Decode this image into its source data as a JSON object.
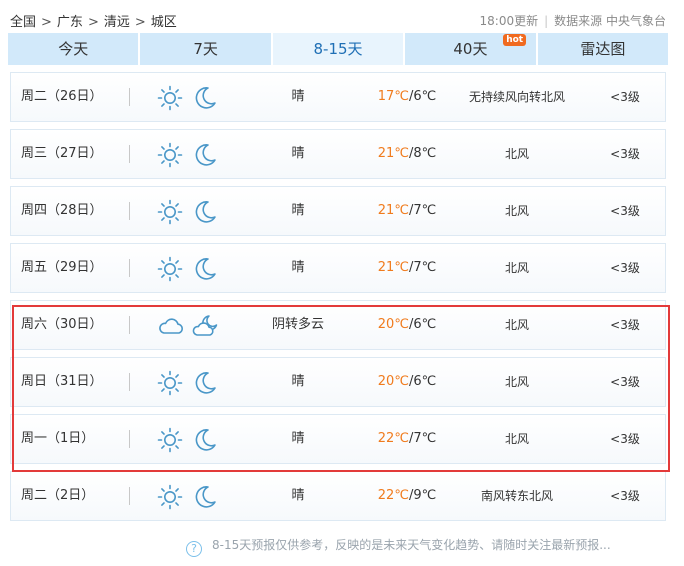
{
  "breadcrumb": {
    "items": [
      "全国",
      "广东",
      "清远",
      "城区"
    ],
    "separator": ">"
  },
  "meta": {
    "update_time": "18:00更新",
    "source": "数据来源 中央气象台"
  },
  "tabs": [
    {
      "label": "今天"
    },
    {
      "label": "7天"
    },
    {
      "label": "8-15天"
    },
    {
      "label": "40天",
      "badge": "hot"
    },
    {
      "label": "雷达图"
    }
  ],
  "active_tab": "8-15天",
  "colors": {
    "accent": "#1f6fb5",
    "tab_bg": "#d2e9fa",
    "high_temp": "#f07b1d",
    "highlight": "#e33a3a",
    "hot_badge": "#f06a1f",
    "icon": "#4a97c8"
  },
  "forecast": [
    {
      "date": "周二（26日）",
      "day_icon": "sun-icon",
      "night_icon": "moon-icon",
      "weather": "晴",
      "high": "17℃",
      "low": "/6℃",
      "wind": "无持续风向转北风",
      "level": "<3级"
    },
    {
      "date": "周三（27日）",
      "day_icon": "sun-icon",
      "night_icon": "moon-icon",
      "weather": "晴",
      "high": "21℃",
      "low": "/8℃",
      "wind": "北风",
      "level": "<3级"
    },
    {
      "date": "周四（28日）",
      "day_icon": "sun-icon",
      "night_icon": "moon-icon",
      "weather": "晴",
      "high": "21℃",
      "low": "/7℃",
      "wind": "北风",
      "level": "<3级"
    },
    {
      "date": "周五（29日）",
      "day_icon": "sun-icon",
      "night_icon": "moon-icon",
      "weather": "晴",
      "high": "21℃",
      "low": "/7℃",
      "wind": "北风",
      "level": "<3级"
    },
    {
      "date": "周六（30日）",
      "day_icon": "cloud-icon",
      "night_icon": "cloud-moon-icon",
      "weather": "阴转多云",
      "high": "20℃",
      "low": "/6℃",
      "wind": "北风",
      "level": "<3级"
    },
    {
      "date": "周日（31日）",
      "day_icon": "sun-icon",
      "night_icon": "moon-icon",
      "weather": "晴",
      "high": "20℃",
      "low": "/6℃",
      "wind": "北风",
      "level": "<3级"
    },
    {
      "date": "周一（1日）",
      "day_icon": "sun-icon",
      "night_icon": "moon-icon",
      "weather": "晴",
      "high": "22℃",
      "low": "/7℃",
      "wind": "北风",
      "level": "<3级"
    },
    {
      "date": "周二（2日）",
      "day_icon": "sun-icon",
      "night_icon": "moon-icon",
      "weather": "晴",
      "high": "22℃",
      "low": "/9℃",
      "wind": "南风转东北风",
      "level": "<3级"
    }
  ],
  "footer": {
    "help_glyph": "?",
    "note": "8-15天预报仅供参考，反映的是未来天气变化趋势、请随时关注最新预报..."
  }
}
